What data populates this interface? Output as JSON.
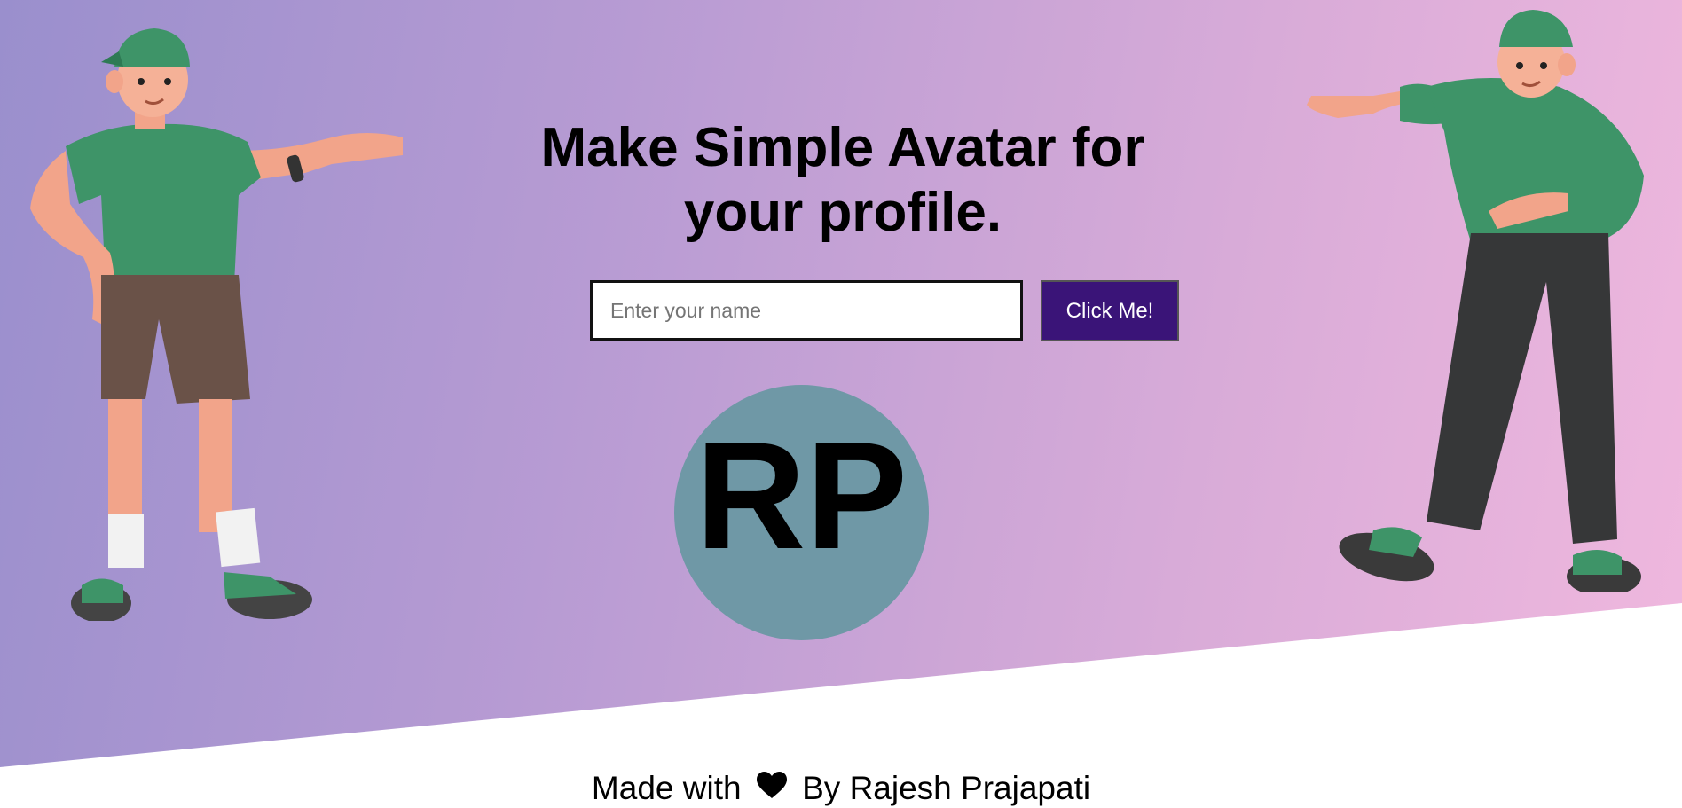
{
  "header": {
    "title": "Make Simple Avatar for your profile."
  },
  "form": {
    "name_placeholder": "Enter your name",
    "name_value": "",
    "button_label": "Click Me!"
  },
  "avatar": {
    "initials": "RP",
    "background_color": "#6f98a6"
  },
  "footer": {
    "prefix": "Made with",
    "icon": "heart-icon",
    "suffix": "By Rajesh Prajapati"
  },
  "colors": {
    "gradient_start": "#9a8fcd",
    "gradient_end": "#f0b8de",
    "button_bg": "#3a1478"
  },
  "illustrations": {
    "left": "3d-character-left",
    "right": "3d-character-right"
  }
}
